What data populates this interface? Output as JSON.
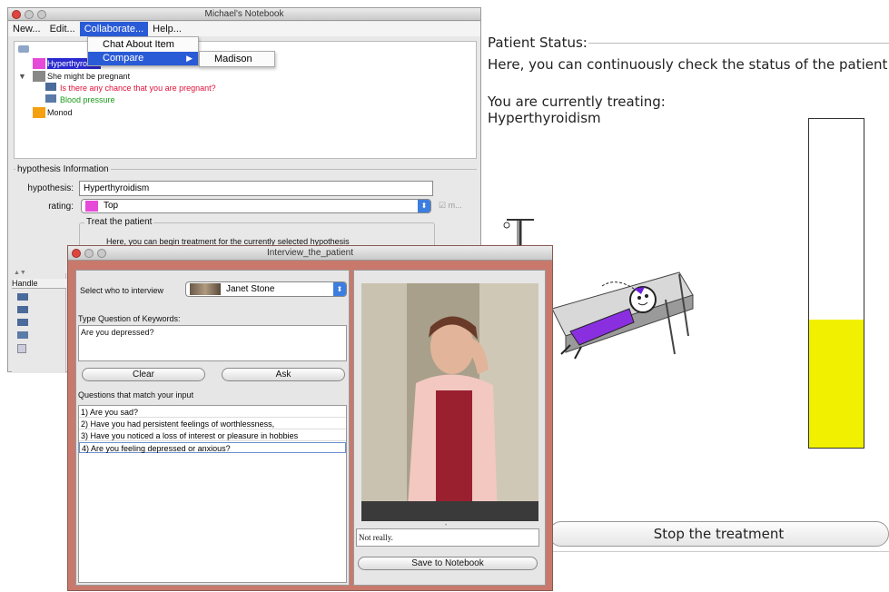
{
  "status": {
    "title": "Patient Status:",
    "description": "Here, you can continuously check the status of the patient",
    "treating_label": "You are currently treating:",
    "treating_value": "Hyperthyroidism",
    "meter_level": 0.39,
    "meter_color": "#f0f000",
    "stop_button": "Stop the treatment"
  },
  "notebook": {
    "title": "Michael's Notebook",
    "menu": [
      "New...",
      "Edit...",
      "Collaborate...",
      "Help..."
    ],
    "dropdown": [
      "Chat About Item",
      "Compare"
    ],
    "submenu": [
      "Madison"
    ],
    "tree": {
      "item1": "Hyperthyroidism",
      "item2": "She might be pregnant",
      "item3": "Is there any chance that you are pregnant?",
      "item4": "Blood pressure",
      "item5": "Monod"
    },
    "info": {
      "legend": "hypothesis Information",
      "hypothesis_label": "hypothesis:",
      "hypothesis_value": "Hyperthyroidism",
      "rating_label": "rating:",
      "rating_value": "Top",
      "check_label": "m...",
      "treat_legend": "Treat the patient",
      "treat_text": "Here, you can begin treatment for the currently selected hypothesis"
    },
    "handle_label": "Handle"
  },
  "interview": {
    "title": "Interview_the_patient",
    "select_label": "Select who to interview",
    "selected_person": "Janet Stone",
    "keyword_label": "Type Question of Keywords:",
    "keyword_value": "Are you depressed?",
    "clear_button": "Clear",
    "ask_button": "Ask",
    "matches_label": "Questions that match your input",
    "questions": [
      "1) Are you sad?",
      "2) Have you had persistent feelings of worthlessness,",
      "3) Have you noticed a loss of interest or pleasure in hobbies",
      "4) Are you feeling depressed or anxious?"
    ],
    "answer": "Not really.",
    "save_button": "Save to Notebook"
  }
}
